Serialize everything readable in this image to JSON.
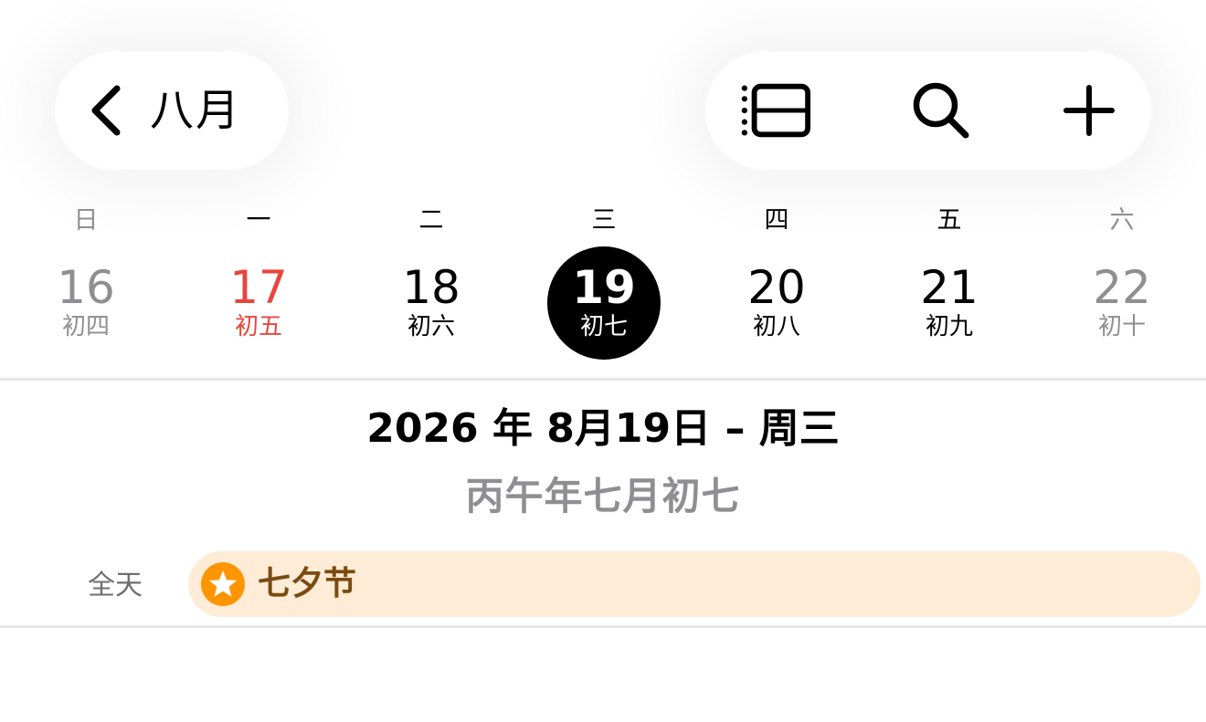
{
  "header": {
    "back_label": "八月",
    "back_icon": "chevron-left-icon",
    "actions": [
      {
        "name": "list-view-icon"
      },
      {
        "name": "search-icon"
      },
      {
        "name": "add-icon"
      }
    ]
  },
  "week": {
    "days": [
      {
        "weekday": "日",
        "day": "16",
        "lunar": "初四",
        "style": "muted"
      },
      {
        "weekday": "一",
        "day": "17",
        "lunar": "初五",
        "style": "red"
      },
      {
        "weekday": "二",
        "day": "18",
        "lunar": "初六",
        "style": "normal"
      },
      {
        "weekday": "三",
        "day": "19",
        "lunar": "初七",
        "style": "selected"
      },
      {
        "weekday": "四",
        "day": "20",
        "lunar": "初八",
        "style": "normal"
      },
      {
        "weekday": "五",
        "day": "21",
        "lunar": "初九",
        "style": "normal"
      },
      {
        "weekday": "六",
        "day": "22",
        "lunar": "初十",
        "style": "muted"
      }
    ]
  },
  "detail": {
    "date_title": "2026 年 8月19日 – 周三",
    "lunar_title": "丙午年七月初七"
  },
  "allday": {
    "label": "全天",
    "event": {
      "title": "七夕节",
      "icon": "star-icon"
    }
  },
  "colors": {
    "accent_red": "#e8453c",
    "muted": "#8e8e93",
    "event_bg": "#feecd7",
    "event_icon": "#ff9500",
    "event_text": "#7a4a10"
  }
}
